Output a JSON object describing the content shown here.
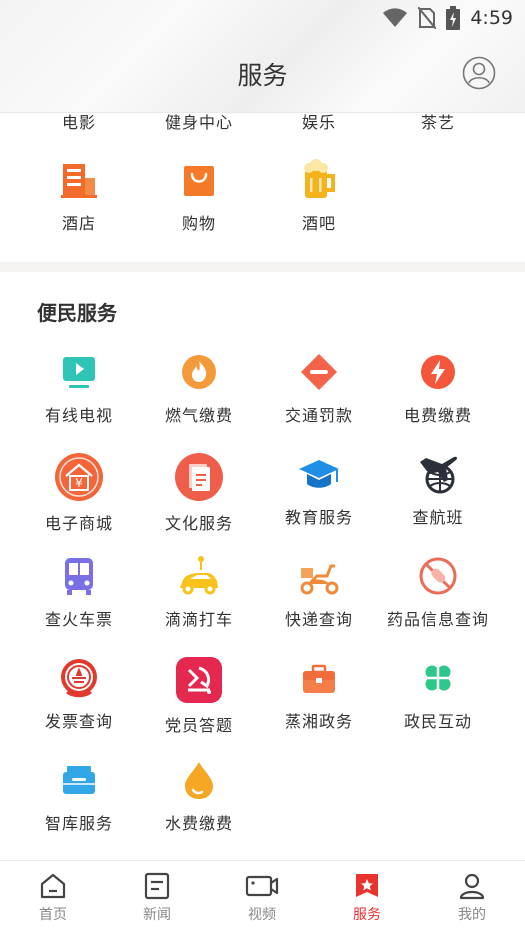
{
  "status_bar": {
    "time": "4:59"
  },
  "header": {
    "title": "服务"
  },
  "top_section": {
    "cut_labels": [
      "电影",
      "健身中心",
      "娱乐",
      "茶艺"
    ],
    "items": [
      {
        "label": "酒店",
        "icon": "hotel-icon"
      },
      {
        "label": "购物",
        "icon": "shopping-bag-icon"
      },
      {
        "label": "酒吧",
        "icon": "beer-mug-icon"
      }
    ]
  },
  "convenience": {
    "title": "便民服务",
    "items": [
      {
        "label": "有线电视",
        "icon": "tv-icon"
      },
      {
        "label": "燃气缴费",
        "icon": "gas-flame-icon"
      },
      {
        "label": "交通罚款",
        "icon": "traffic-sign-icon"
      },
      {
        "label": "电费缴费",
        "icon": "lightning-icon"
      },
      {
        "label": "电子商城",
        "icon": "mall-icon"
      },
      {
        "label": "文化服务",
        "icon": "culture-icon"
      },
      {
        "label": "教育服务",
        "icon": "graduation-cap-icon"
      },
      {
        "label": "查航班",
        "icon": "airplane-icon"
      },
      {
        "label": "查火车票",
        "icon": "bus-icon"
      },
      {
        "label": "滴滴打车",
        "icon": "car-icon"
      },
      {
        "label": "快递查询",
        "icon": "scooter-icon"
      },
      {
        "label": "药品信息查询",
        "icon": "pill-icon"
      },
      {
        "label": "发票查询",
        "icon": "emblem-icon"
      },
      {
        "label": "党员答题",
        "icon": "party-icon"
      },
      {
        "label": "蒸湘政务",
        "icon": "briefcase-icon"
      },
      {
        "label": "政民互动",
        "icon": "clover-icon"
      },
      {
        "label": "智库服务",
        "icon": "archive-box-icon"
      },
      {
        "label": "水费缴费",
        "icon": "water-drop-icon"
      }
    ]
  },
  "tabbar": {
    "items": [
      {
        "label": "首页",
        "icon": "home-icon"
      },
      {
        "label": "新闻",
        "icon": "news-icon"
      },
      {
        "label": "视频",
        "icon": "video-icon"
      },
      {
        "label": "服务",
        "icon": "service-icon",
        "active": true
      },
      {
        "label": "我的",
        "icon": "person-icon"
      }
    ],
    "active_color": "#e8332f",
    "inactive_color": "#888888"
  }
}
